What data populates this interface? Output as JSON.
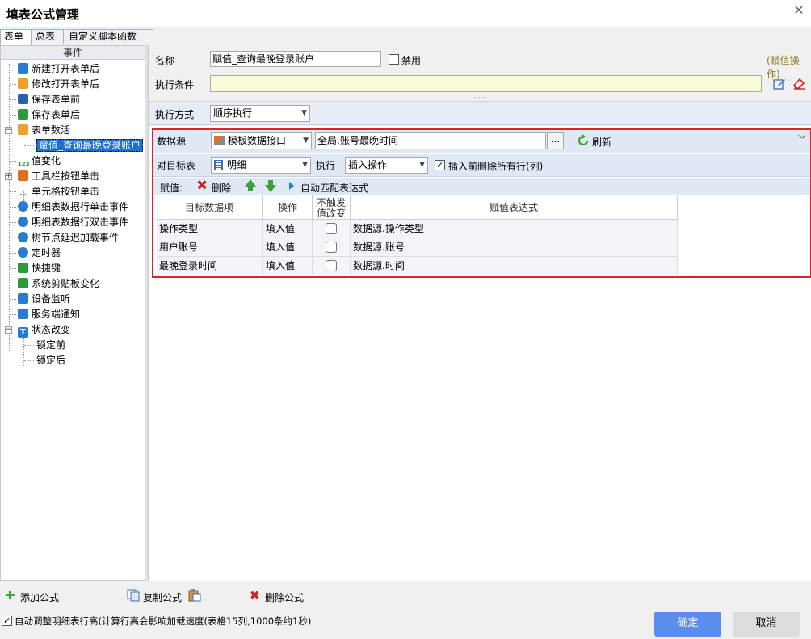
{
  "window": {
    "title": "填表公式管理",
    "close_glyph": "✕"
  },
  "tabs": [
    "表单",
    "总表",
    "自定义脚本函数"
  ],
  "events_panel": {
    "header": "事件",
    "items": [
      {
        "label": "新建打开表单后",
        "icon": "new-open-icon",
        "color": "#2a7ad2"
      },
      {
        "label": "修改打开表单后",
        "icon": "folder-open-icon",
        "color": "#f0a030"
      },
      {
        "label": "保存表单前",
        "icon": "save-before-icon",
        "color": "#2a5fb0"
      },
      {
        "label": "保存表单后",
        "icon": "save-after-icon",
        "color": "#2e9a3a"
      },
      {
        "label": "表单数活",
        "icon": "folder-icon",
        "color": "#f0a030",
        "expander": "−"
      },
      {
        "label": "赋值_查询最晚登录账户",
        "selected": true
      },
      {
        "label": "值变化",
        "icon": "value-change-icon",
        "color": "#2e9a3a",
        "text_icon": "123"
      },
      {
        "label": "工具栏按钮单击",
        "icon": "tools-icon",
        "color": "#e07020",
        "expander": "+"
      },
      {
        "label": "单元格按钮单击",
        "icon": "cell-button-icon",
        "color": "#2a7ad2",
        "text_icon": "···"
      },
      {
        "label": "明细表数据行单击事件",
        "icon": "row-click-icon",
        "color": "#2a7ad2"
      },
      {
        "label": "明细表数据行双击事件",
        "icon": "row-dblclick-icon",
        "color": "#2a7ad2"
      },
      {
        "label": "树节点延迟加载事件",
        "icon": "tree-lazy-icon",
        "color": "#2a7ad2"
      },
      {
        "label": "定时器",
        "icon": "timer-icon",
        "color": "#2a7ad2"
      },
      {
        "label": "快捷键",
        "icon": "shortcut-icon",
        "color": "#2e9a3a"
      },
      {
        "label": "系统剪贴板变化",
        "icon": "clipboard-icon",
        "color": "#2e9a3a"
      },
      {
        "label": "设备监听",
        "icon": "device-icon",
        "color": "#2a7ad2"
      },
      {
        "label": "服务端通知",
        "icon": "server-notify-icon",
        "color": "#2a7ad2"
      },
      {
        "label": "状态改变",
        "icon": "state-icon",
        "color": "#2a7ad2",
        "expander": "−",
        "text_icon": "T"
      },
      {
        "label": "锁定前",
        "child": true
      },
      {
        "label": "锁定后",
        "child": true
      }
    ]
  },
  "form": {
    "name_label": "名称",
    "name_value": "赋值_查询最晚登录账户",
    "disable_label": "禁用",
    "op_hint": "(赋值操作)",
    "condition_label": "执行条件",
    "condition_value": "",
    "exec_mode_label": "执行方式",
    "exec_mode_value": "顺序执行"
  },
  "assign": {
    "datasource_label": "数据源",
    "datasource_value": "模板数据接口",
    "datasource_expr": "全局.账号最晚时间",
    "ellipsis": "...",
    "refresh_label": "刷新",
    "target_label": "对目标表",
    "target_value": "明细",
    "exec_label": "执行",
    "exec_value": "插入操作",
    "clear_before_label": "插入前删除所有行(列)",
    "clear_before_checked": true,
    "assign_label": "赋值:",
    "delete_label": "删除",
    "automatch_label": "自动匹配表达式",
    "columns": [
      "目标数据项",
      "操作",
      "不触发值改变",
      "赋值表达式"
    ],
    "rows": [
      {
        "target": "操作类型",
        "op": "填入值",
        "no_trigger": false,
        "expr": "数据源.操作类型"
      },
      {
        "target": "用户账号",
        "op": "填入值",
        "no_trigger": false,
        "expr": "数据源.账号"
      },
      {
        "target": "最晚登录时间",
        "op": "填入值",
        "no_trigger": false,
        "expr": "数据源.时间"
      }
    ]
  },
  "bottom": {
    "add_label": "添加公式",
    "copy_label": "复制公式",
    "delete_label": "删除公式",
    "autoheight_label": "自动调整明细表行高(计算行高会影响加载速度(表格15列,1000条约1秒)",
    "autoheight_checked": true,
    "ok_label": "确定",
    "cancel_label": "取消"
  },
  "colors": {
    "accent": "#5b8def",
    "highlight_border": "#e0202a",
    "selected": "#1f6fd0",
    "condition_bg": "#fbfbd8"
  }
}
